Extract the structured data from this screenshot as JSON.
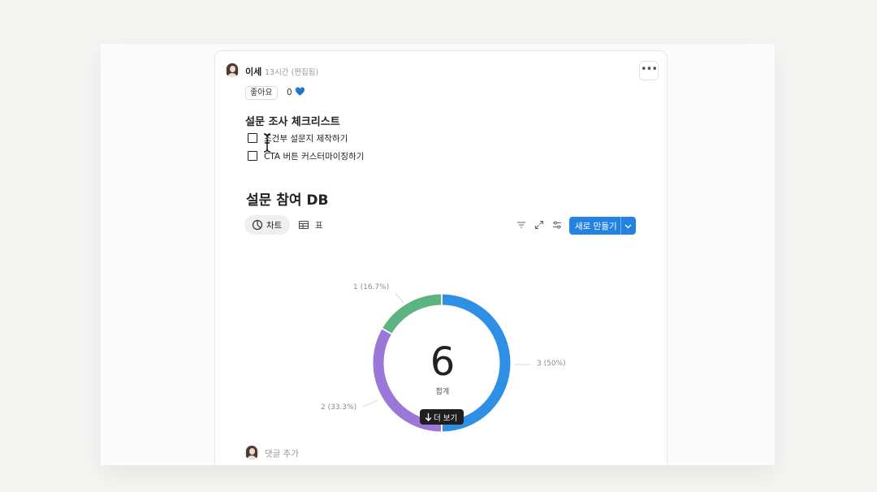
{
  "post": {
    "author": "이세",
    "time": "13시간 (편집됨)",
    "more_icon": "ellipsis-icon"
  },
  "reaction": {
    "like_label": "좋아요",
    "count": "0",
    "heart": "💙"
  },
  "checklist": {
    "title": "설문 조사 체크리스트",
    "items": [
      {
        "label": "조건부 설문지 제작하기",
        "checked": false
      },
      {
        "label": "CTA 버튼 커스터마이징하기",
        "checked": false
      }
    ]
  },
  "database": {
    "title": "설문 참여 DB",
    "tabs": [
      {
        "label": "차트",
        "icon": "pie-chart-icon",
        "active": true
      },
      {
        "label": "표",
        "icon": "table-icon",
        "active": false
      }
    ],
    "tools": [
      "filter-icon",
      "expand-icon",
      "settings-sliders-icon"
    ],
    "new_button": "새로 만들기"
  },
  "chart_data": {
    "type": "pie",
    "variant": "donut",
    "total": "6",
    "total_label": "합계",
    "slices": [
      {
        "value": 3,
        "label": "3 (50%)",
        "color": "#2f8fe4"
      },
      {
        "value": 2,
        "label": "2 (33.3%)",
        "color": "#9b77d8"
      },
      {
        "value": 1,
        "label": "1 (16.7%)",
        "color": "#5cb482"
      }
    ]
  },
  "more_view": "더 보기",
  "comment_placeholder": "댓글 추가",
  "colors": {
    "accent": "#2383e2",
    "page_bg": "#f4f4f3"
  }
}
